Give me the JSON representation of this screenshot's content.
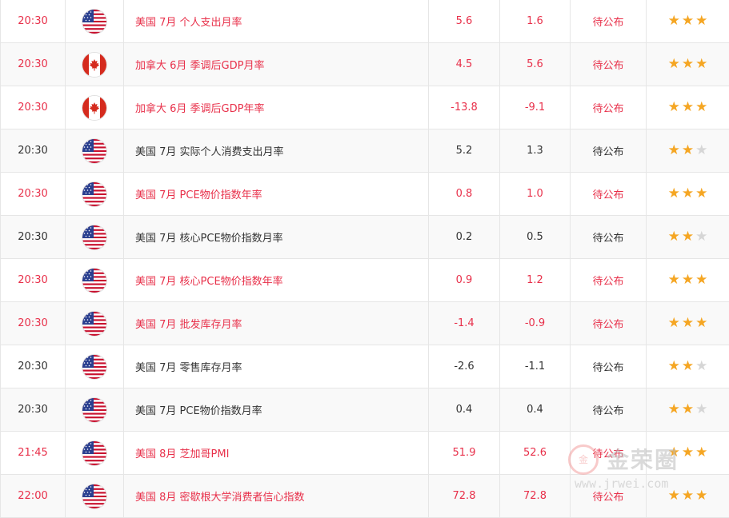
{
  "colors": {
    "highlight": "#e8304a",
    "normal": "#333333",
    "star_on": "#f5a623",
    "star_off": "#d6d6d6"
  },
  "status_label": "待公布",
  "watermark": {
    "logo": "金",
    "title": "金荣圈",
    "url": "www.jrwei.com"
  },
  "rows": [
    {
      "time": "20:30",
      "flag": "us-flag",
      "name": "美国 7月 个人支出月率",
      "prev": "5.6",
      "forecast": "1.6",
      "actual": "待公布",
      "importance": 3,
      "highlight": true
    },
    {
      "time": "20:30",
      "flag": "ca-flag",
      "name": "加拿大 6月 季调后GDP月率",
      "prev": "4.5",
      "forecast": "5.6",
      "actual": "待公布",
      "importance": 3,
      "highlight": true
    },
    {
      "time": "20:30",
      "flag": "ca-flag",
      "name": "加拿大 6月 季调后GDP年率",
      "prev": "-13.8",
      "forecast": "-9.1",
      "actual": "待公布",
      "importance": 3,
      "highlight": true
    },
    {
      "time": "20:30",
      "flag": "us-flag",
      "name": "美国 7月 实际个人消费支出月率",
      "prev": "5.2",
      "forecast": "1.3",
      "actual": "待公布",
      "importance": 2,
      "highlight": false
    },
    {
      "time": "20:30",
      "flag": "us-flag",
      "name": "美国 7月 PCE物价指数年率",
      "prev": "0.8",
      "forecast": "1.0",
      "actual": "待公布",
      "importance": 3,
      "highlight": true
    },
    {
      "time": "20:30",
      "flag": "us-flag",
      "name": "美国 7月 核心PCE物价指数月率",
      "prev": "0.2",
      "forecast": "0.5",
      "actual": "待公布",
      "importance": 2,
      "highlight": false
    },
    {
      "time": "20:30",
      "flag": "us-flag",
      "name": "美国 7月 核心PCE物价指数年率",
      "prev": "0.9",
      "forecast": "1.2",
      "actual": "待公布",
      "importance": 3,
      "highlight": true
    },
    {
      "time": "20:30",
      "flag": "us-flag",
      "name": "美国 7月 批发库存月率",
      "prev": "-1.4",
      "forecast": "-0.9",
      "actual": "待公布",
      "importance": 3,
      "highlight": true
    },
    {
      "time": "20:30",
      "flag": "us-flag",
      "name": "美国 7月 零售库存月率",
      "prev": "-2.6",
      "forecast": "-1.1",
      "actual": "待公布",
      "importance": 2,
      "highlight": false
    },
    {
      "time": "20:30",
      "flag": "us-flag",
      "name": "美国 7月 PCE物价指数月率",
      "prev": "0.4",
      "forecast": "0.4",
      "actual": "待公布",
      "importance": 2,
      "highlight": false
    },
    {
      "time": "21:45",
      "flag": "us-flag",
      "name": "美国 8月 芝加哥PMI",
      "prev": "51.9",
      "forecast": "52.6",
      "actual": "待公布",
      "importance": 3,
      "highlight": true
    },
    {
      "time": "22:00",
      "flag": "us-flag",
      "name": "美国 8月 密歇根大学消费者信心指数",
      "prev": "72.8",
      "forecast": "72.8",
      "actual": "待公布",
      "importance": 3,
      "highlight": true
    }
  ]
}
